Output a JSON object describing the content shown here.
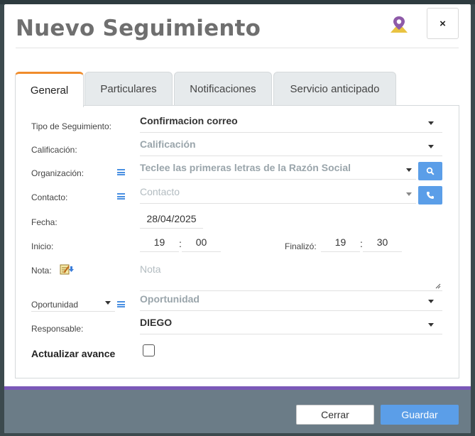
{
  "modal": {
    "title": "Nuevo Seguimiento",
    "close_label": "×"
  },
  "tabs": [
    {
      "label": "General",
      "active": true
    },
    {
      "label": "Particulares",
      "active": false
    },
    {
      "label": "Notificaciones",
      "active": false
    },
    {
      "label": "Servicio anticipado",
      "active": false
    }
  ],
  "form": {
    "tipo": {
      "label": "Tipo de Seguimiento:",
      "value": "Confirmacion correo"
    },
    "calificacion": {
      "label": "Calificación:",
      "placeholder": "Calificación"
    },
    "organizacion": {
      "label": "Organización:",
      "placeholder": "Teclee las primeras letras de la Razón Social"
    },
    "contacto": {
      "label": "Contacto:",
      "placeholder": "Contacto"
    },
    "fecha": {
      "label": "Fecha:",
      "value": "28/04/2025"
    },
    "inicio": {
      "label": "Inicio:",
      "hour": "19",
      "minute": "00"
    },
    "finalizo": {
      "label": "Finalizó:",
      "hour": "19",
      "minute": "30"
    },
    "time_separator": ":",
    "nota": {
      "label": "Nota:",
      "placeholder": "Nota"
    },
    "oportunidad": {
      "select_label": "Oportunidad",
      "placeholder": "Oportunidad"
    },
    "responsable": {
      "label": "Responsable:",
      "value": "DIEGO"
    },
    "actualizar_avance": {
      "label": "Actualizar avance",
      "checked": false
    }
  },
  "footer": {
    "cancel_label": "Cerrar",
    "save_label": "Guardar"
  },
  "colors": {
    "accent_tab": "#f08c2c",
    "primary_button": "#5b9ee8",
    "footer_bar": "#6b7c87",
    "footer_stripe": "#7a58b8",
    "map_pin": "#8e5aa8",
    "map_fold": "#e9c341"
  },
  "icons": [
    "map-pin-icon",
    "close-icon",
    "list-icon",
    "search-icon",
    "phone-icon",
    "note-download-icon",
    "caret-down-icon"
  ]
}
